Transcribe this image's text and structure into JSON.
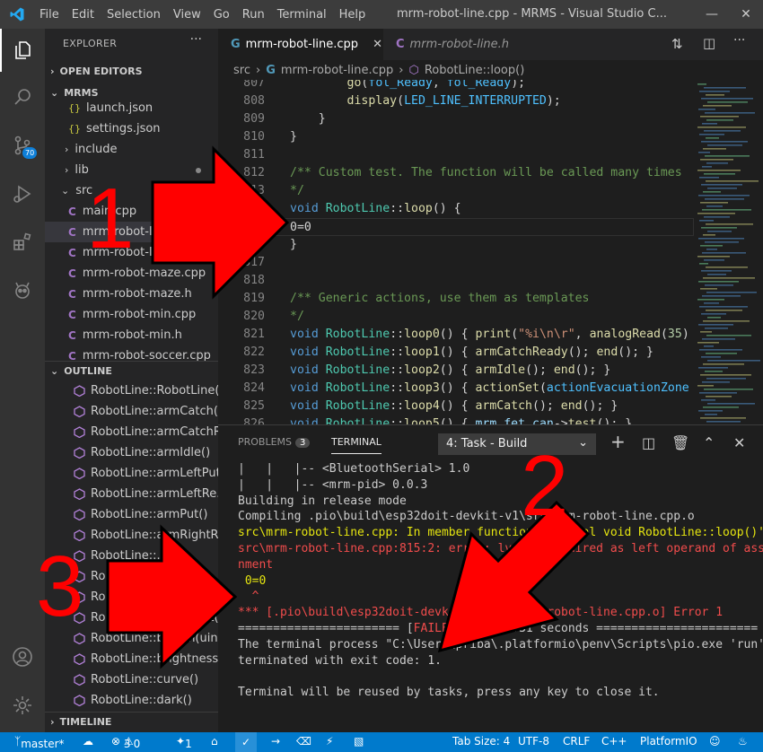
{
  "titlebar": {
    "menu": [
      "File",
      "Edit",
      "Selection",
      "View",
      "Go",
      "Run",
      "Terminal",
      "Help"
    ],
    "title": "mrm-robot-line.cpp - MRMS - Visual Studio C..."
  },
  "activity": {
    "scm_badge": "70"
  },
  "sidebar": {
    "header": "EXPLORER",
    "open_editors": "OPEN EDITORS",
    "workspace": "MRMS",
    "files": [
      {
        "label": "launch.json",
        "kind": "json"
      },
      {
        "label": "settings.json",
        "kind": "json"
      },
      {
        "label": "include",
        "kind": "folder"
      },
      {
        "label": "lib",
        "kind": "folder"
      },
      {
        "label": "src",
        "kind": "folder-open"
      },
      {
        "label": "main.cpp",
        "kind": "cpp"
      },
      {
        "label": "mrm-robot-line.cpp",
        "kind": "cpp"
      },
      {
        "label": "mrm-robot-line.h",
        "kind": "cpp"
      },
      {
        "label": "mrm-robot-maze.cpp",
        "kind": "cpp"
      },
      {
        "label": "mrm-robot-maze.h",
        "kind": "cpp"
      },
      {
        "label": "mrm-robot-min.cpp",
        "kind": "cpp"
      },
      {
        "label": "mrm-robot-min.h",
        "kind": "cpp"
      },
      {
        "label": "mrm-robot-soccer.cpp",
        "kind": "cpp"
      }
    ],
    "outline_title": "OUTLINE",
    "outline": [
      "RobotLine::RobotLine(...",
      "RobotLine::armCatch()",
      "RobotLine::armCatchR...",
      "RobotLine::armIdle()",
      "RobotLine::armLeftPut()",
      "RobotLine::armLeftRe...",
      "RobotLine::armPut()",
      "RobotLine::armRightRea...",
      "RobotLine::...",
      "RobotLine::...",
      "RobotLine::...",
      "RobotLine::bottonSet()",
      "RobotLine::button(uin...",
      "RobotLine::brightness...",
      "RobotLine::curve()",
      "RobotLine::dark()"
    ],
    "timeline": "TIMELINE"
  },
  "tabs": [
    {
      "label": "mrm-robot-line.cpp",
      "active": true
    },
    {
      "label": "mrm-robot-line.h",
      "active": false
    }
  ],
  "breadcrumb": [
    "src",
    "mrm-robot-line.cpp",
    "RobotLine::loop()"
  ],
  "code": [
    {
      "n": "807",
      "t": "        go(fol_Ready, fol_Ready);"
    },
    {
      "n": "808",
      "t": "        display(LED_LINE_INTERRUPTED);"
    },
    {
      "n": "809",
      "t": "    }"
    },
    {
      "n": "810",
      "t": "}"
    },
    {
      "n": "811",
      "t": ""
    },
    {
      "n": "812",
      "t": "/** Custom test. The function will be called many times"
    },
    {
      "n": "813",
      "t": "*/"
    },
    {
      "n": "814",
      "t": "void RobotLine::loop() {"
    },
    {
      "n": "815",
      "t": "0=0"
    },
    {
      "n": "816",
      "t": "}"
    },
    {
      "n": "817",
      "t": ""
    },
    {
      "n": "818",
      "t": ""
    },
    {
      "n": "819",
      "t": "/** Generic actions, use them as templates"
    },
    {
      "n": "820",
      "t": "*/"
    },
    {
      "n": "821",
      "t": "void RobotLine::loop0() { print(\"%i\\n\\r\", analogRead(35)"
    },
    {
      "n": "822",
      "t": "void RobotLine::loop1() { armCatchReady(); end(); }"
    },
    {
      "n": "823",
      "t": "void RobotLine::loop2() { armIdle(); end(); }"
    },
    {
      "n": "824",
      "t": "void RobotLine::loop3() { actionSet(actionEvacuationZone"
    },
    {
      "n": "825",
      "t": "void RobotLine::loop4() { armCatch(); end(); }"
    },
    {
      "n": "826",
      "t": "void RobotLine::loop5() { mrm_fet_can->test(); }"
    }
  ],
  "panel": {
    "problems_label": "PROBLEMS",
    "problems_count": "3",
    "terminal_label": "TERMINAL",
    "task": "4: Task - Build",
    "lines": [
      "|   |   |-- <BluetoothSerial> 1.0",
      "|   |   |-- <mrm-pid> 0.0.3",
      "Building in release mode",
      "Compiling .pio\\build\\esp32doit-devkit-v1\\src\\mrm-robot-line.cpp.o",
      "src\\mrm-robot-line.cpp: In member function 'virtual void RobotLine::loop()':",
      "src\\mrm-robot-line.cpp:815:2: error: lvalue required as left operand of assig",
      "nment",
      " 0=0",
      "  ^",
      "*** [.pio\\build\\esp32doit-devkit-v1\\src\\mrm-robot-line.cpp.o] Error 1",
      "======================= [FAILED] Took 9.31 seconds =======================",
      "The terminal process \"C:\\Users\\priba\\.platformio\\penv\\Scripts\\pio.exe 'run'\"",
      "terminated with exit code: 1.",
      "",
      "Terminal will be reused by tasks, press any key to close it."
    ]
  },
  "status": {
    "branch": "master*",
    "problems": "3",
    "warnings": "0",
    "tasks": "1",
    "tab_size": "Tab Size: 4",
    "encoding": "UTF-8",
    "eol": "CRLF",
    "language": "C++",
    "platform": "PlatformIO"
  },
  "annotations": [
    "1",
    "2",
    "3"
  ],
  "colors": {
    "accent": "#007acc",
    "arrow": "#ff0000",
    "error": "#f14c4c",
    "warn": "#e5e510"
  }
}
